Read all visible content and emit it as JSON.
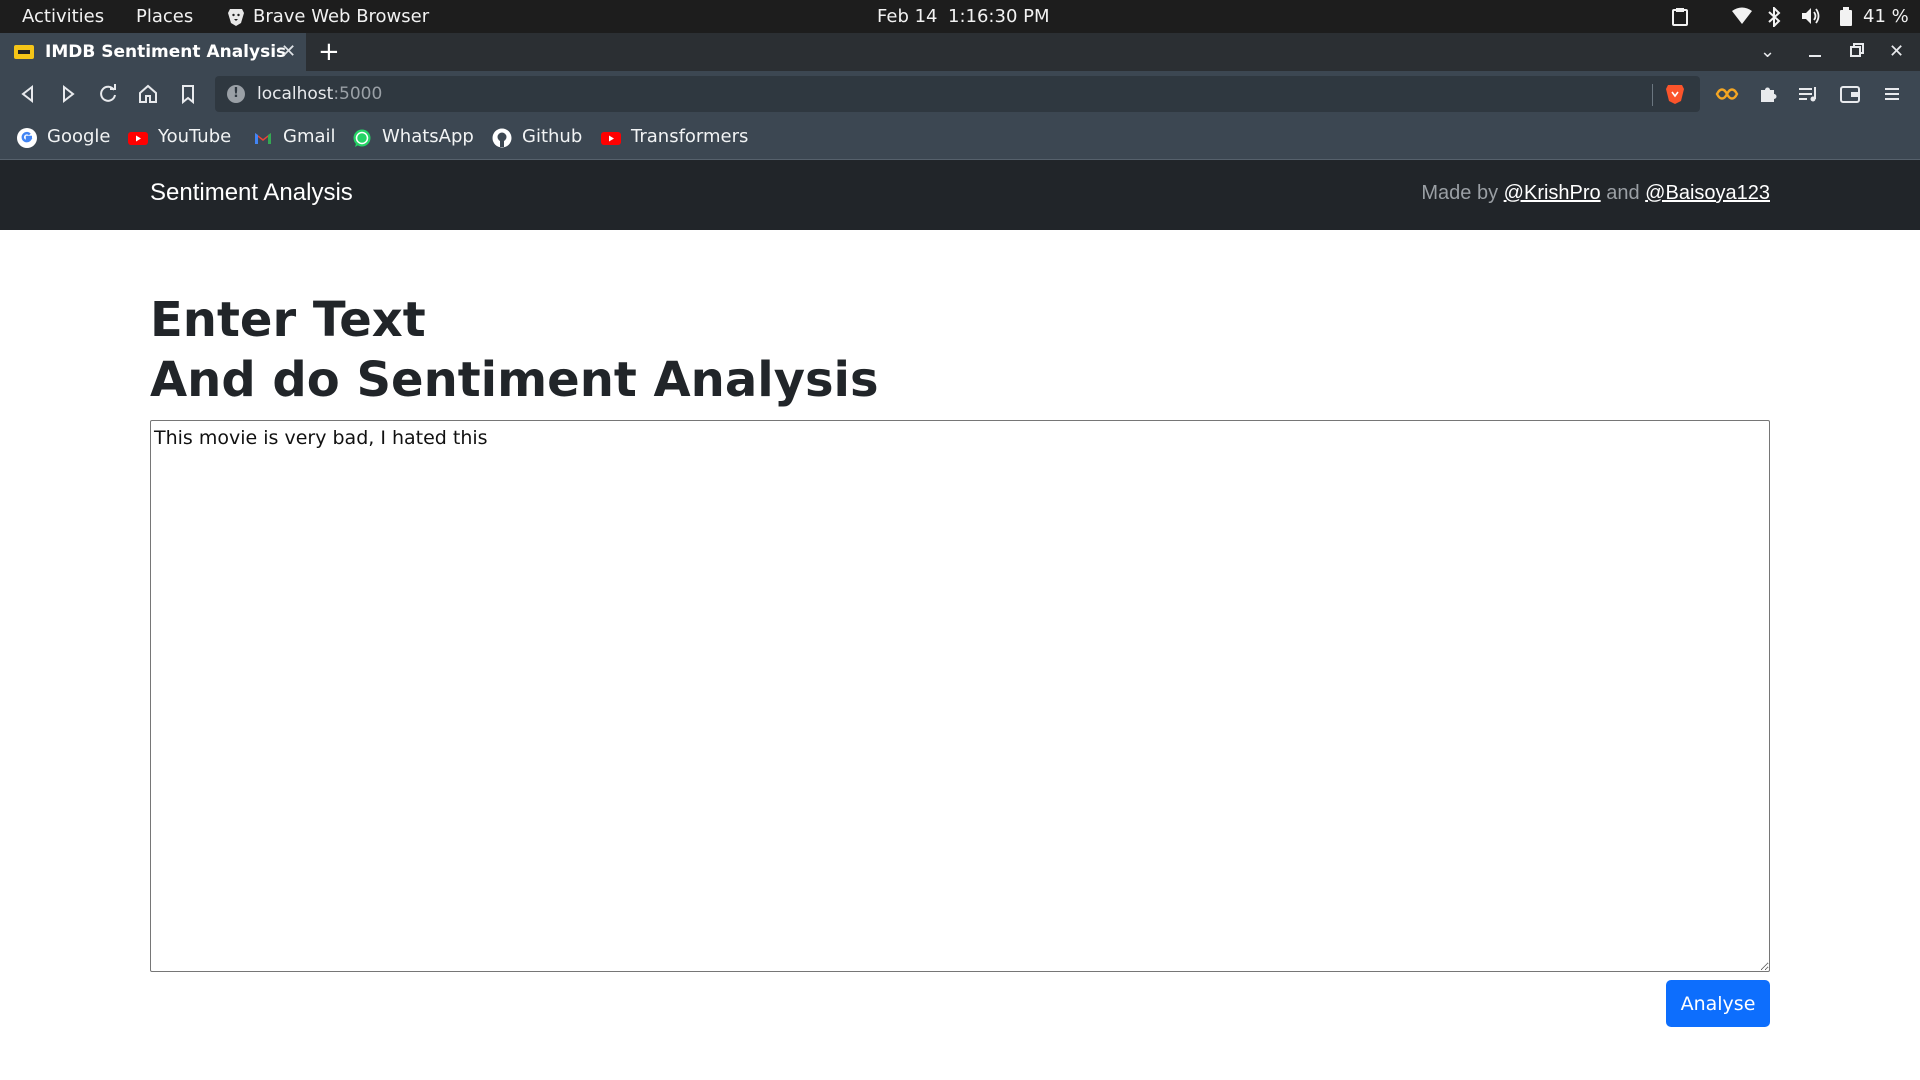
{
  "system_bar": {
    "activities": "Activities",
    "places": "Places",
    "app_name": "Brave Web Browser",
    "date": "Feb 14",
    "time": "1:16:30 PM",
    "battery": "41 %"
  },
  "browser": {
    "tab_title": "IMDB Sentiment Analysis",
    "url_host": "localhost",
    "url_port": ":5000",
    "bookmarks": [
      {
        "label": "Google"
      },
      {
        "label": "YouTube"
      },
      {
        "label": "Gmail"
      },
      {
        "label": "WhatsApp"
      },
      {
        "label": "Github"
      },
      {
        "label": "Transformers"
      }
    ]
  },
  "site": {
    "brand": "Sentiment Analysis",
    "made_by_prefix": "Made by",
    "author1": "@KrishPro",
    "and_text": "and",
    "author2": "@Baisoya123"
  },
  "main": {
    "heading_line1": "Enter Text",
    "heading_line2": "And do Sentiment Analysis",
    "textarea_value": "This movie is very bad, I hated this",
    "analyse_label": "Analyse"
  },
  "colors": {
    "navbar": "#212529",
    "primary_button": "#0d6efd",
    "browser_chrome": "#3c4752"
  }
}
